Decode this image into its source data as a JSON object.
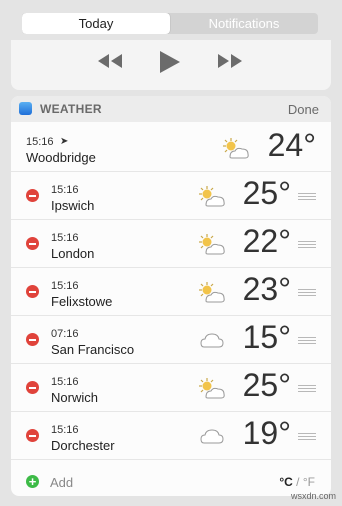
{
  "tabs": {
    "today": "Today",
    "notifications": "Notifications"
  },
  "media": [
    "rewind-icon",
    "play-icon",
    "fast-forward-icon"
  ],
  "weather": {
    "title": "WEATHER",
    "done": "Done",
    "rows": [
      {
        "time": "15:16",
        "city": "Woodbridge",
        "temp": "24°",
        "icon": "partly-sunny-icon",
        "current": true
      },
      {
        "time": "15:16",
        "city": "Ipswich",
        "temp": "25°",
        "icon": "partly-sunny-icon"
      },
      {
        "time": "15:16",
        "city": "London",
        "temp": "22°",
        "icon": "partly-sunny-icon"
      },
      {
        "time": "15:16",
        "city": "Felixstowe",
        "temp": "23°",
        "icon": "partly-sunny-icon"
      },
      {
        "time": "07:16",
        "city": "San Francisco",
        "temp": "15°",
        "icon": "cloud-icon"
      },
      {
        "time": "15:16",
        "city": "Norwich",
        "temp": "25°",
        "icon": "partly-sunny-icon"
      },
      {
        "time": "15:16",
        "city": "Dorchester",
        "temp": "19°",
        "icon": "cloud-icon"
      }
    ],
    "add": "Add",
    "unit_c": "°C",
    "unit_sep": "/",
    "unit_f": "°F"
  },
  "watermark": "wsxdn.com"
}
